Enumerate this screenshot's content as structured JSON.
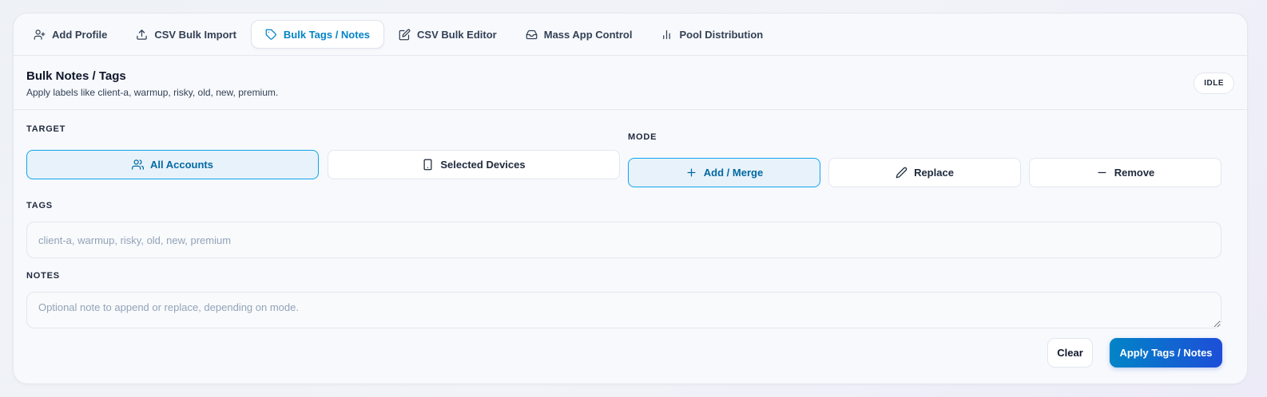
{
  "tabs": [
    {
      "label": "Add Profile",
      "icon": "user-plus-icon",
      "active": false
    },
    {
      "label": "CSV Bulk Import",
      "icon": "upload-icon",
      "active": false
    },
    {
      "label": "Bulk Tags / Notes",
      "icon": "tag-icon",
      "active": true
    },
    {
      "label": "CSV Bulk Editor",
      "icon": "edit-icon",
      "active": false
    },
    {
      "label": "Mass App Control",
      "icon": "inbox-icon",
      "active": false
    },
    {
      "label": "Pool Distribution",
      "icon": "bar-chart-icon",
      "active": false
    }
  ],
  "header": {
    "title": "Bulk Notes / Tags",
    "subtitle": "Apply labels like client-a, warmup, risky, old, new, premium.",
    "status": "IDLE"
  },
  "target": {
    "label": "TARGET",
    "options": [
      {
        "label": "All Accounts",
        "icon": "users-icon",
        "selected": true
      },
      {
        "label": "Selected Devices",
        "icon": "smartphone-icon",
        "selected": false
      }
    ]
  },
  "mode": {
    "label": "MODE",
    "options": [
      {
        "label": "Add / Merge",
        "icon": "plus-icon",
        "selected": true
      },
      {
        "label": "Replace",
        "icon": "pencil-icon",
        "selected": false
      },
      {
        "label": "Remove",
        "icon": "minus-icon",
        "selected": false
      }
    ]
  },
  "tags": {
    "label": "TAGS",
    "value": "",
    "placeholder": "client-a, warmup, risky, old, new, premium"
  },
  "notes": {
    "label": "NOTES",
    "value": "",
    "placeholder": "Optional note to append or replace, depending on mode."
  },
  "actions": {
    "clear_label": "Clear",
    "apply_label": "Apply Tags / Notes"
  },
  "colors": {
    "accent": "#0284c7",
    "accent_dark": "#1d4ed8",
    "selected_bg": "#e8f2fb"
  }
}
